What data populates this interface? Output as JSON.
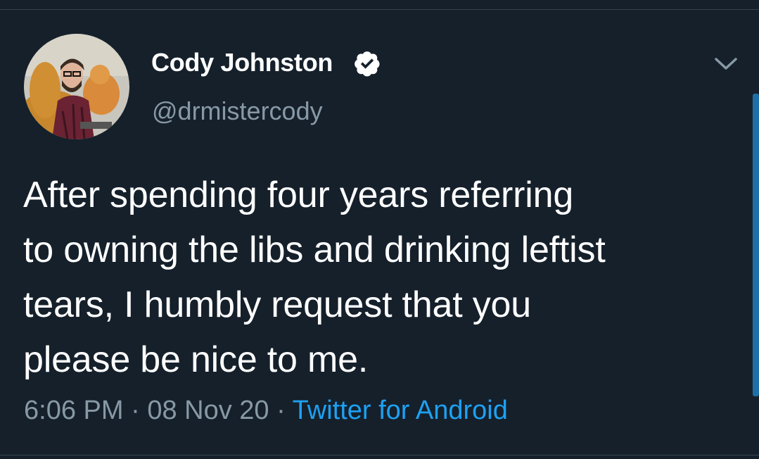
{
  "tweet": {
    "author": {
      "name": "Cody Johnston",
      "handle": "@drmistercody",
      "verified": true
    },
    "text_lines": [
      "After spending four years referring",
      "to owning the libs and drinking leftist",
      "tears, I humbly request that you",
      "please be nice to me."
    ],
    "time": "6:06 PM",
    "separator": " · ",
    "date": "08 Nov 20",
    "source": "Twitter for Android"
  },
  "colors": {
    "background": "#15202b",
    "text": "#ffffff",
    "secondary_text": "#8899a6",
    "link": "#1da1f2",
    "divider": "#38444d"
  },
  "icons": {
    "verified": "verified-badge-icon",
    "menu": "chevron-down-icon"
  }
}
